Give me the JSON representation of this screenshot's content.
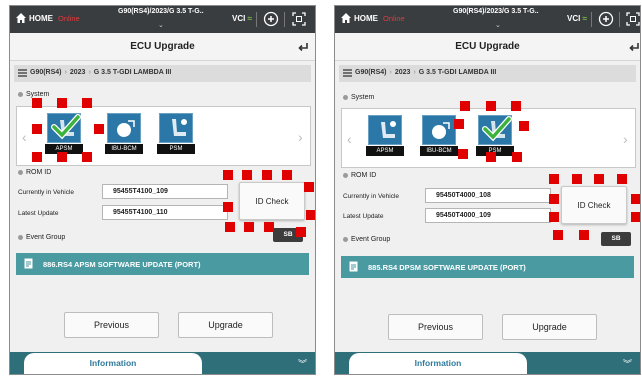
{
  "colors": {
    "topbar": "#3a3d40",
    "accent_teal": "#4a9aa2",
    "online_red": "#e03a3a",
    "highlight_red": "#e00000"
  },
  "screens": [
    {
      "topbar": {
        "home_label": "HOME",
        "status_label": "Online",
        "vehicle_title": "G90(RS4)/2023/G 3.5 T-G..",
        "vci_label": "VCI"
      },
      "page_title": "ECU Upgrade",
      "breadcrumb": [
        "G90(RS4)",
        "2023",
        "G 3.5 T-GDI LAMBDA III"
      ],
      "system": {
        "label": "System",
        "items": [
          {
            "name": "APSM",
            "icon": "seat-check-icon",
            "selected": true
          },
          {
            "name": "IBU-BCM",
            "icon": "ibu-bcm-icon",
            "selected": false
          },
          {
            "name": "PSM",
            "icon": "power-seat-icon",
            "selected": false
          }
        ]
      },
      "rom_id": {
        "label": "ROM ID",
        "current_label": "Currently in Vehicle",
        "current_value": "95455T4100_109",
        "latest_label": "Latest Update",
        "latest_value": "95455T4100_110"
      },
      "id_check_label": "ID Check",
      "usb_label": "SB",
      "event_group": {
        "label": "Event Group",
        "item": "886.RS4 APSM SOFTWARE UPDATE (PORT)"
      },
      "buttons": {
        "previous": "Previous",
        "upgrade": "Upgrade"
      },
      "info_tab": "Information"
    },
    {
      "topbar": {
        "home_label": "HOME",
        "status_label": "Online",
        "vehicle_title": "G90(RS4)/2023/G 3.5 T-G..",
        "vci_label": "VCI"
      },
      "page_title": "ECU Upgrade",
      "breadcrumb": [
        "G90(RS4)",
        "2023",
        "G 3.5 T-GDI LAMBDA III"
      ],
      "system": {
        "label": "System",
        "items": [
          {
            "name": "APSM",
            "icon": "seat-icon",
            "selected": false
          },
          {
            "name": "IBU-BCM",
            "icon": "ibu-bcm-icon",
            "selected": false
          },
          {
            "name": "PSM",
            "icon": "power-seat-check-icon",
            "selected": true
          }
        ]
      },
      "rom_id": {
        "label": "ROM ID",
        "current_label": "Currently in Vehicle",
        "current_value": "95450T4000_108",
        "latest_label": "Latest Update",
        "latest_value": "95450T4000_109"
      },
      "id_check_label": "ID Check",
      "usb_label": "SB",
      "event_group": {
        "label": "Event Group",
        "item": "885.RS4 DPSM SOFTWARE UPDATE (PORT)"
      },
      "buttons": {
        "previous": "Previous",
        "upgrade": "Upgrade"
      },
      "info_tab": "Information"
    }
  ]
}
